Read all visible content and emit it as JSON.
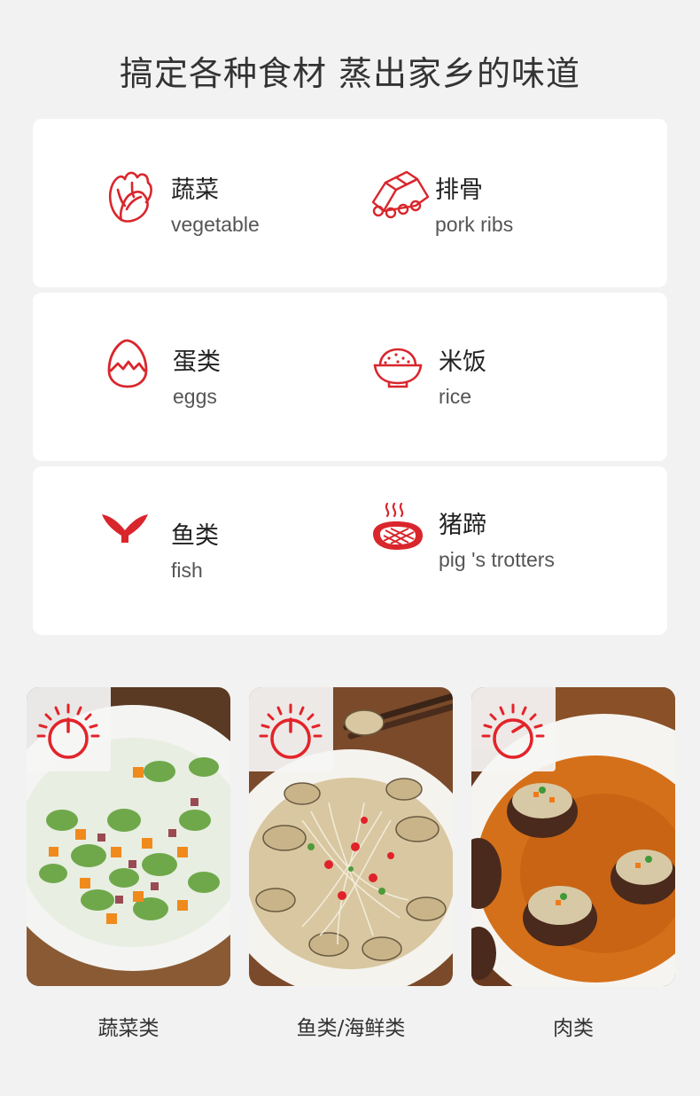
{
  "headline": "搞定各种食材  蒸出家乡的味道",
  "accent_color": "#d9262c",
  "ingredients": [
    {
      "icon": "cabbage-icon",
      "cn": "蔬菜",
      "en": "vegetable"
    },
    {
      "icon": "pork-ribs-icon",
      "cn": "排骨",
      "en": "pork ribs"
    },
    {
      "icon": "egg-icon",
      "cn": "蛋类",
      "en": "eggs"
    },
    {
      "icon": "rice-bowl-icon",
      "cn": "米饭",
      "en": "rice"
    },
    {
      "icon": "fish-tail-icon",
      "cn": "鱼类",
      "en": "fish"
    },
    {
      "icon": "steak-icon",
      "cn": "猪蹄",
      "en": "pig 's trotters"
    }
  ],
  "dishes": [
    {
      "icon": "timer-dial-icon",
      "image": "broad-beans-carrot-dish",
      "caption": "蔬菜类"
    },
    {
      "icon": "timer-dial-icon",
      "image": "clams-vermicelli-dish",
      "caption": "鱼类/海鲜类"
    },
    {
      "icon": "timer-dial-icon",
      "image": "stuffed-mushrooms-dish",
      "caption": "肉类"
    }
  ]
}
